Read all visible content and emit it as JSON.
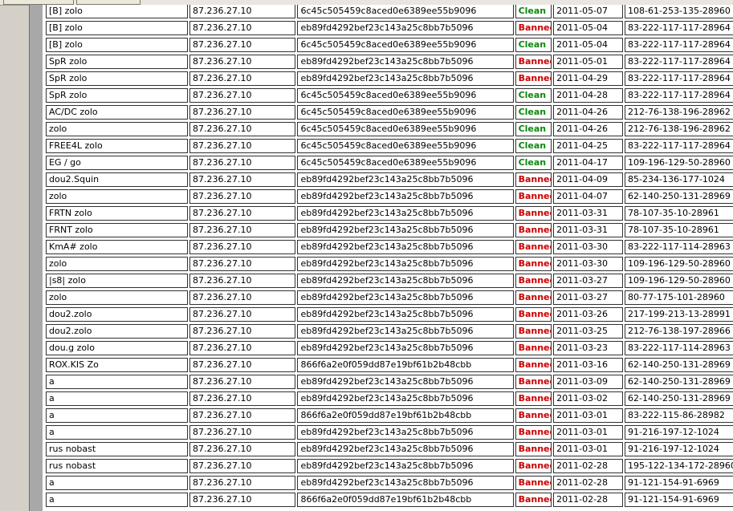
{
  "colors": {
    "clean": "#0a8a0a",
    "banned": "#cc0000"
  },
  "rows": [
    {
      "name": "[B] zolo",
      "ip": "87.236.27.10",
      "hash": "6c45c505459c8aced0e6389ee55b9096",
      "status": "Clean",
      "date": "2011-05-07",
      "conn": "108-61-253-135-28960"
    },
    {
      "name": "[B] zolo",
      "ip": "87.236.27.10",
      "hash": "eb89fd4292bef23c143a25c8bb7b5096",
      "status": "Banned",
      "date": "2011-05-04",
      "conn": "83-222-117-117-28964"
    },
    {
      "name": "[B] zolo",
      "ip": "87.236.27.10",
      "hash": "6c45c505459c8aced0e6389ee55b9096",
      "status": "Clean",
      "date": "2011-05-04",
      "conn": "83-222-117-117-28964"
    },
    {
      "name": "SpR zolo",
      "ip": "87.236.27.10",
      "hash": "eb89fd4292bef23c143a25c8bb7b5096",
      "status": "Banned",
      "date": "2011-05-01",
      "conn": "83-222-117-117-28964"
    },
    {
      "name": "SpR zolo",
      "ip": "87.236.27.10",
      "hash": "eb89fd4292bef23c143a25c8bb7b5096",
      "status": "Banned",
      "date": "2011-04-29",
      "conn": "83-222-117-117-28964"
    },
    {
      "name": "SpR zolo",
      "ip": "87.236.27.10",
      "hash": "6c45c505459c8aced0e6389ee55b9096",
      "status": "Clean",
      "date": "2011-04-28",
      "conn": "83-222-117-117-28964"
    },
    {
      "name": "AC/DC zolo",
      "ip": "87.236.27.10",
      "hash": "6c45c505459c8aced0e6389ee55b9096",
      "status": "Clean",
      "date": "2011-04-26",
      "conn": "212-76-138-196-28962"
    },
    {
      "name": "zolo",
      "ip": "87.236.27.10",
      "hash": "6c45c505459c8aced0e6389ee55b9096",
      "status": "Clean",
      "date": "2011-04-26",
      "conn": "212-76-138-196-28962"
    },
    {
      "name": "FREE4L zolo",
      "ip": "87.236.27.10",
      "hash": "6c45c505459c8aced0e6389ee55b9096",
      "status": "Clean",
      "date": "2011-04-25",
      "conn": "83-222-117-117-28964"
    },
    {
      "name": "EG / go",
      "ip": "87.236.27.10",
      "hash": "6c45c505459c8aced0e6389ee55b9096",
      "status": "Clean",
      "date": "2011-04-17",
      "conn": "109-196-129-50-28960"
    },
    {
      "name": "dou2.Squin",
      "ip": "87.236.27.10",
      "hash": "eb89fd4292bef23c143a25c8bb7b5096",
      "status": "Banned",
      "date": "2011-04-09",
      "conn": "85-234-136-177-1024"
    },
    {
      "name": "zolo",
      "ip": "87.236.27.10",
      "hash": "eb89fd4292bef23c143a25c8bb7b5096",
      "status": "Banned",
      "date": "2011-04-07",
      "conn": "62-140-250-131-28969"
    },
    {
      "name": "FRTN zolo",
      "ip": "87.236.27.10",
      "hash": "eb89fd4292bef23c143a25c8bb7b5096",
      "status": "Banned",
      "date": "2011-03-31",
      "conn": "78-107-35-10-28961"
    },
    {
      "name": "FRNT zolo",
      "ip": "87.236.27.10",
      "hash": "eb89fd4292bef23c143a25c8bb7b5096",
      "status": "Banned",
      "date": "2011-03-31",
      "conn": "78-107-35-10-28961"
    },
    {
      "name": "KmA# zolo",
      "ip": "87.236.27.10",
      "hash": "eb89fd4292bef23c143a25c8bb7b5096",
      "status": "Banned",
      "date": "2011-03-30",
      "conn": "83-222-117-114-28963"
    },
    {
      "name": "zolo",
      "ip": "87.236.27.10",
      "hash": "eb89fd4292bef23c143a25c8bb7b5096",
      "status": "Banned",
      "date": "2011-03-30",
      "conn": "109-196-129-50-28960"
    },
    {
      "name": "|s8| zolo",
      "ip": "87.236.27.10",
      "hash": "eb89fd4292bef23c143a25c8bb7b5096",
      "status": "Banned",
      "date": "2011-03-27",
      "conn": "109-196-129-50-28960"
    },
    {
      "name": "zolo",
      "ip": "87.236.27.10",
      "hash": "eb89fd4292bef23c143a25c8bb7b5096",
      "status": "Banned",
      "date": "2011-03-27",
      "conn": "80-77-175-101-28960"
    },
    {
      "name": "dou2.zolo",
      "ip": "87.236.27.10",
      "hash": "eb89fd4292bef23c143a25c8bb7b5096",
      "status": "Banned",
      "date": "2011-03-26",
      "conn": "217-199-213-13-28991"
    },
    {
      "name": "dou2.zolo",
      "ip": "87.236.27.10",
      "hash": "eb89fd4292bef23c143a25c8bb7b5096",
      "status": "Banned",
      "date": "2011-03-25",
      "conn": "212-76-138-197-28966"
    },
    {
      "name": "dou.g zolo",
      "ip": "87.236.27.10",
      "hash": "eb89fd4292bef23c143a25c8bb7b5096",
      "status": "Banned",
      "date": "2011-03-23",
      "conn": "83-222-117-114-28963"
    },
    {
      "name": "ROX.KIS Zo",
      "ip": "87.236.27.10",
      "hash": "866f6a2e0f059dd87e19bf61b2b48cbb",
      "status": "Banned",
      "date": "2011-03-16",
      "conn": "62-140-250-131-28969"
    },
    {
      "name": "a",
      "ip": "87.236.27.10",
      "hash": "eb89fd4292bef23c143a25c8bb7b5096",
      "status": "Banned",
      "date": "2011-03-09",
      "conn": "62-140-250-131-28969"
    },
    {
      "name": "a",
      "ip": "87.236.27.10",
      "hash": "eb89fd4292bef23c143a25c8bb7b5096",
      "status": "Banned",
      "date": "2011-03-02",
      "conn": "62-140-250-131-28969"
    },
    {
      "name": "a",
      "ip": "87.236.27.10",
      "hash": "866f6a2e0f059dd87e19bf61b2b48cbb",
      "status": "Banned",
      "date": "2011-03-01",
      "conn": "83-222-115-86-28982"
    },
    {
      "name": "a",
      "ip": "87.236.27.10",
      "hash": "eb89fd4292bef23c143a25c8bb7b5096",
      "status": "Banned",
      "date": "2011-03-01",
      "conn": "91-216-197-12-1024"
    },
    {
      "name": "rus nobast",
      "ip": "87.236.27.10",
      "hash": "eb89fd4292bef23c143a25c8bb7b5096",
      "status": "Banned",
      "date": "2011-03-01",
      "conn": "91-216-197-12-1024"
    },
    {
      "name": "rus nobast",
      "ip": "87.236.27.10",
      "hash": "eb89fd4292bef23c143a25c8bb7b5096",
      "status": "Banned",
      "date": "2011-02-28",
      "conn": "195-122-134-172-28960"
    },
    {
      "name": "a",
      "ip": "87.236.27.10",
      "hash": "eb89fd4292bef23c143a25c8bb7b5096",
      "status": "Banned",
      "date": "2011-02-28",
      "conn": "91-121-154-91-6969"
    },
    {
      "name": "a",
      "ip": "87.236.27.10",
      "hash": "866f6a2e0f059dd87e19bf61b2b48cbb",
      "status": "Banned",
      "date": "2011-02-28",
      "conn": "91-121-154-91-6969"
    }
  ]
}
